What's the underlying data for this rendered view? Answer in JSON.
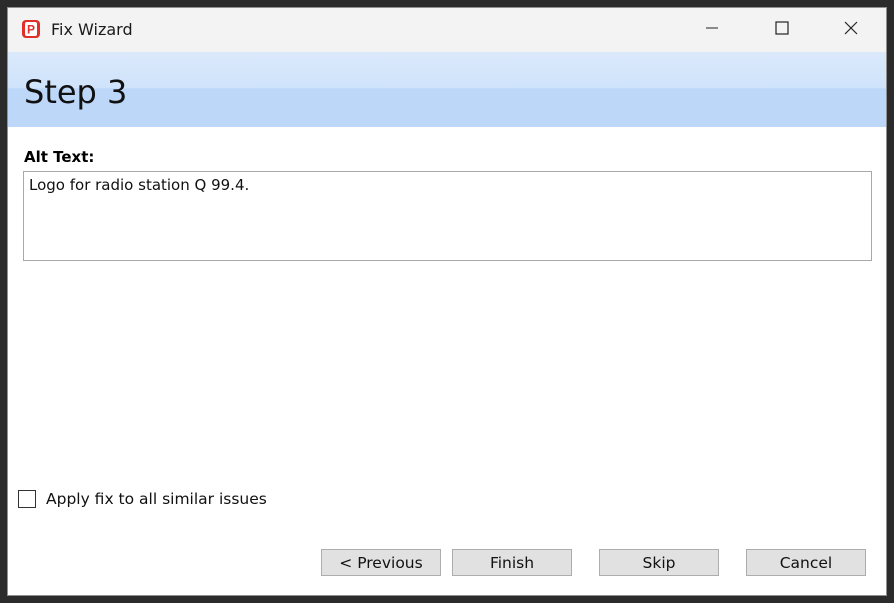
{
  "window": {
    "title": "Fix Wizard",
    "app_icon": "pdf-app-icon"
  },
  "titlebar_controls": {
    "minimize_icon": "minimize-icon",
    "maximize_icon": "maximize-icon",
    "close_icon": "close-icon"
  },
  "header": {
    "step_title": "Step 3"
  },
  "form": {
    "alt_text_label": "Alt Text:",
    "alt_text_value": "Logo for radio station Q 99.4."
  },
  "options": {
    "apply_all_label": "Apply fix to all similar issues",
    "apply_all_checked": false
  },
  "buttons": {
    "previous": "< Previous",
    "finish": "Finish",
    "skip": "Skip",
    "cancel": "Cancel"
  },
  "colors": {
    "header_band": "#bcd7f8",
    "app_icon_red": "#e0302a",
    "button_face": "#e1e1e1"
  }
}
